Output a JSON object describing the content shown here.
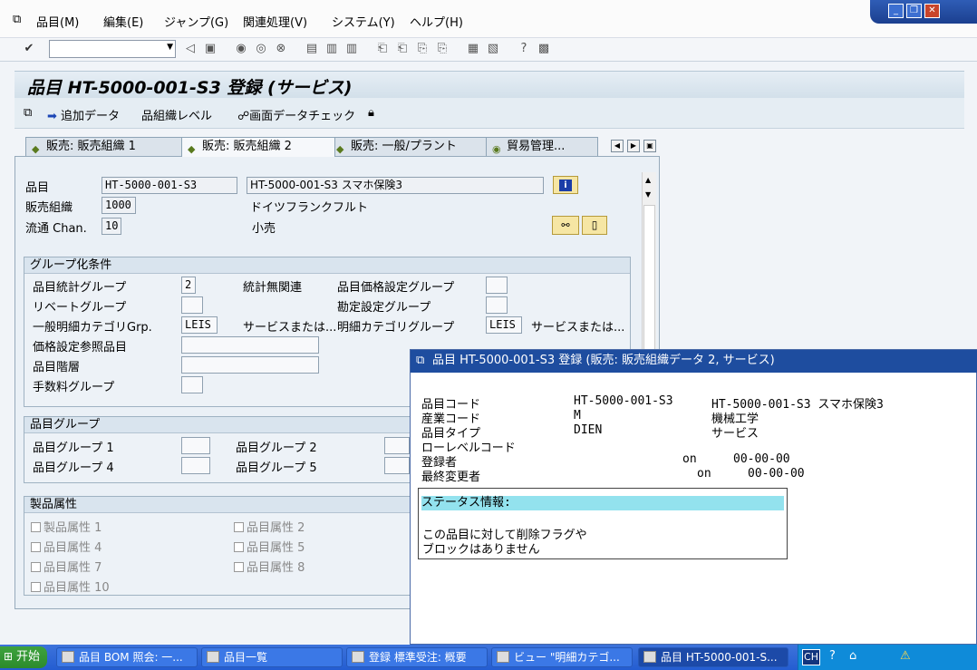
{
  "menu": {
    "items": [
      "品目(M)",
      "編集(E)",
      "ジャンプ(G)",
      "関連処理(V)",
      "システム(Y)",
      "ヘルプ(H)"
    ]
  },
  "window_controls": {
    "minimize": "_",
    "restore": "❐",
    "close": "✕"
  },
  "page": {
    "title": "品目 HT-5000-001-S3 登録 (サービス)"
  },
  "app_toolbar": {
    "add_data": "追加データ",
    "org_level": "組織レベル",
    "screen_check": "画面データチェック"
  },
  "tabs": [
    {
      "label": "販売: 販売組織 1"
    },
    {
      "label": "販売: 販売組織 2"
    },
    {
      "label": "販売: 一般/プラント"
    },
    {
      "label": "貿易管理..."
    }
  ],
  "header": {
    "material_label": "品目",
    "material_value": "HT-5000-001-S3",
    "material_desc": "HT-5000-001-S3 スマホ保険3",
    "sales_org_label": "販売組織",
    "sales_org_value": "1000",
    "sales_org_desc": "ドイツフランクフルト",
    "channel_label": "流通 Chan.",
    "channel_value": "10",
    "channel_desc": "小売"
  },
  "grouping": {
    "title": "グループ化条件",
    "stat_group_label": "品目統計グループ",
    "stat_group_value": "2",
    "stat_group_desc": "統計無関連",
    "price_group_label": "品目価格設定グループ",
    "rebate_label": "リベートグループ",
    "acct_group_label": "勘定設定グループ",
    "gen_item_cat_label": "一般明細カテゴリGrp.",
    "gen_item_cat_value": "LEIS",
    "gen_item_cat_desc": "サービスまたは...",
    "item_cat_label": "明細カテゴリグループ",
    "item_cat_value": "LEIS",
    "item_cat_desc": "サービスまたは...",
    "price_ref_label": "価格設定参照品目",
    "hierarchy_label": "品目階層",
    "commission_label": "手数料グループ"
  },
  "material_groups": {
    "title": "品目グループ",
    "g1": "品目グループ 1",
    "g2": "品目グループ 2",
    "g4": "品目グループ 4",
    "g5": "品目グループ 5"
  },
  "product_attributes": {
    "title": "製品属性",
    "a1": "製品属性 1",
    "a2": "品目属性 2",
    "a4": "品目属性 4",
    "a5": "品目属性 5",
    "a7": "品目属性 7",
    "a8": "品目属性 8",
    "a10": "品目属性 10"
  },
  "popup": {
    "title": "品目 HT-5000-001-S3 登録 (販売: 販売組織データ 2, サービス)",
    "material_code_label": "品目コード",
    "material_code_value": "HT-5000-001-S3",
    "material_code_desc": "HT-5000-001-S3 スマホ保険3",
    "industry_label": "産業コード",
    "industry_value": "M",
    "industry_desc": "機械工学",
    "type_label": "品目タイプ",
    "type_value": "DIEN",
    "type_desc": "サービス",
    "low_level_label": "ローレベルコード",
    "created_label": "登録者",
    "created_on": "on",
    "created_date": "00-00-00",
    "changed_label": "最終変更者",
    "changed_on": "on",
    "changed_date": "00-00-00",
    "status_title": "ステータス情報:",
    "status_line1": "この品目に対して削除フラグや",
    "status_line2": "ブロックはありません"
  },
  "taskbar": {
    "start": "开始",
    "tasks": [
      "品目 BOM 照会: 一...",
      "品目一覧",
      "登録 標準受注: 概要",
      "ビュー \"明細カテゴ...",
      "品目 HT-5000-001-S..."
    ],
    "tray_text": "CH"
  },
  "icons": {
    "check": "check-icon",
    "save": "save-icon",
    "back": "back-icon",
    "info": "info-icon"
  }
}
